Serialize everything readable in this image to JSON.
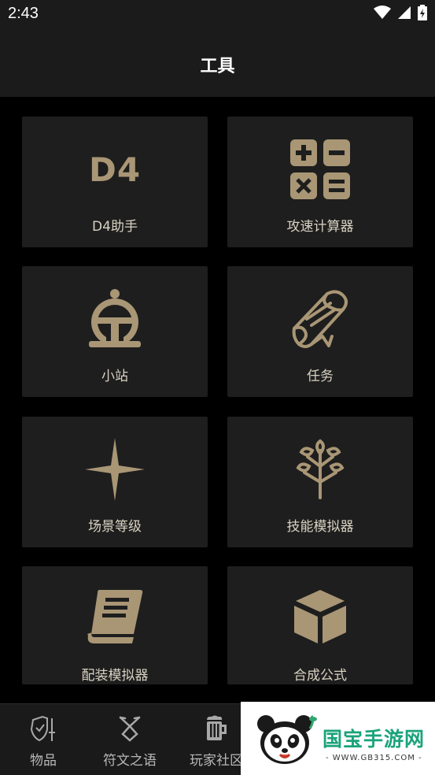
{
  "status_bar": {
    "time": "2:43"
  },
  "header": {
    "title": "工具"
  },
  "tools": [
    {
      "label": "D4助手",
      "icon": "d4-logo-icon",
      "icon_text": "D4"
    },
    {
      "label": "攻速计算器",
      "icon": "calculator-icon"
    },
    {
      "label": "小站",
      "icon": "station-icon"
    },
    {
      "label": "任务",
      "icon": "scroll-icon"
    },
    {
      "label": "场景等级",
      "icon": "star-sparkle-icon"
    },
    {
      "label": "技能模拟器",
      "icon": "skill-tree-icon"
    },
    {
      "label": "配装模拟器",
      "icon": "book-icon"
    },
    {
      "label": "合成公式",
      "icon": "cube-icon"
    }
  ],
  "bottom_nav": [
    {
      "label": "物品",
      "icon": "shield-sword-icon"
    },
    {
      "label": "符文之语",
      "icon": "rune-icon"
    },
    {
      "label": "玩家社区",
      "icon": "beer-mug-icon"
    }
  ],
  "watermark": {
    "title": "国宝手游网",
    "url": "- WWW.GB315.COM -"
  },
  "colors": {
    "accent": "#a99675",
    "tile_bg": "#1e1e1e",
    "bar_bg": "#1b1b1b"
  }
}
